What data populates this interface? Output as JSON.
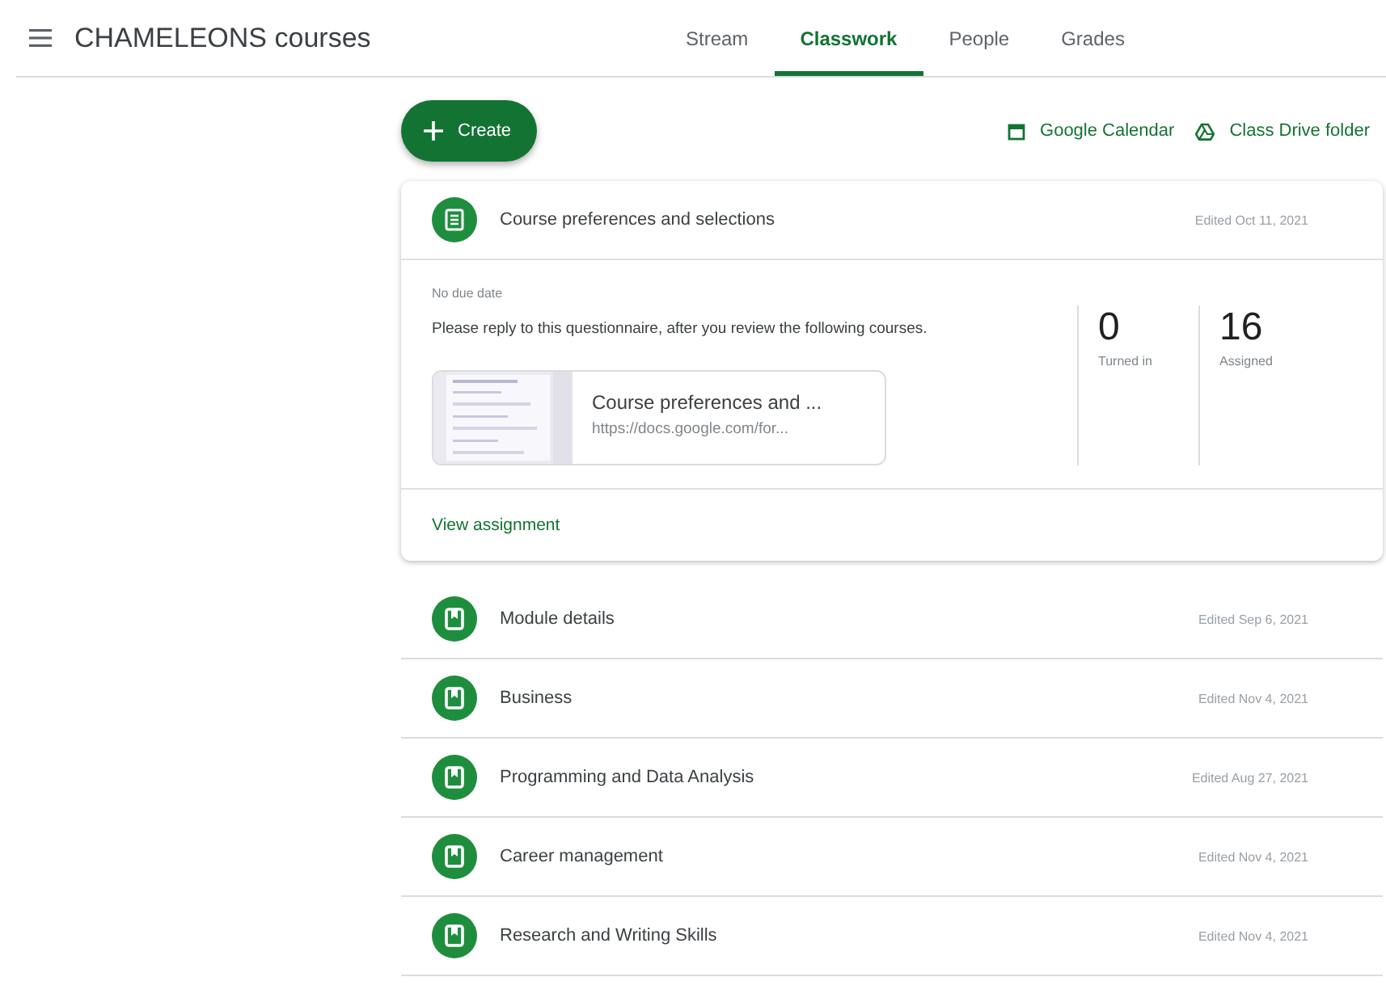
{
  "header": {
    "title": "CHAMELEONS courses"
  },
  "tabs": [
    {
      "label": "Stream",
      "selected": false
    },
    {
      "label": "Classwork",
      "selected": true
    },
    {
      "label": "People",
      "selected": false
    },
    {
      "label": "Grades",
      "selected": false
    }
  ],
  "toolbar": {
    "create": "Create",
    "links": [
      {
        "kind": "calendar",
        "label": "Google Calendar"
      },
      {
        "kind": "drive",
        "label": "Class Drive folder"
      }
    ]
  },
  "items": [
    {
      "kind": "assignment",
      "title": "Course preferences and selections",
      "edited": "Edited Oct 11, 2021",
      "expanded": true,
      "due": "No due date",
      "description": "Please reply to this questionnaire, after you review the following courses.",
      "stats": [
        {
          "value": "0",
          "label": "Turned in"
        },
        {
          "value": "16",
          "label": "Assigned"
        }
      ],
      "attachment": {
        "title": "Course preferences and ...",
        "url": "https://docs.google.com/for..."
      },
      "action": "View assignment"
    },
    {
      "kind": "material",
      "title": "Module details",
      "edited": "Edited Sep 6, 2021",
      "expanded": false
    },
    {
      "kind": "material",
      "title": "Business",
      "edited": "Edited Nov 4, 2021",
      "expanded": false
    },
    {
      "kind": "material",
      "title": "Programming and Data Analysis",
      "edited": "Edited Aug 27, 2021",
      "expanded": false
    },
    {
      "kind": "material",
      "title": "Career management",
      "edited": "Edited Nov 4, 2021",
      "expanded": false
    },
    {
      "kind": "material",
      "title": "Research and Writing Skills",
      "edited": "Edited Nov 4, 2021",
      "expanded": false
    }
  ]
}
